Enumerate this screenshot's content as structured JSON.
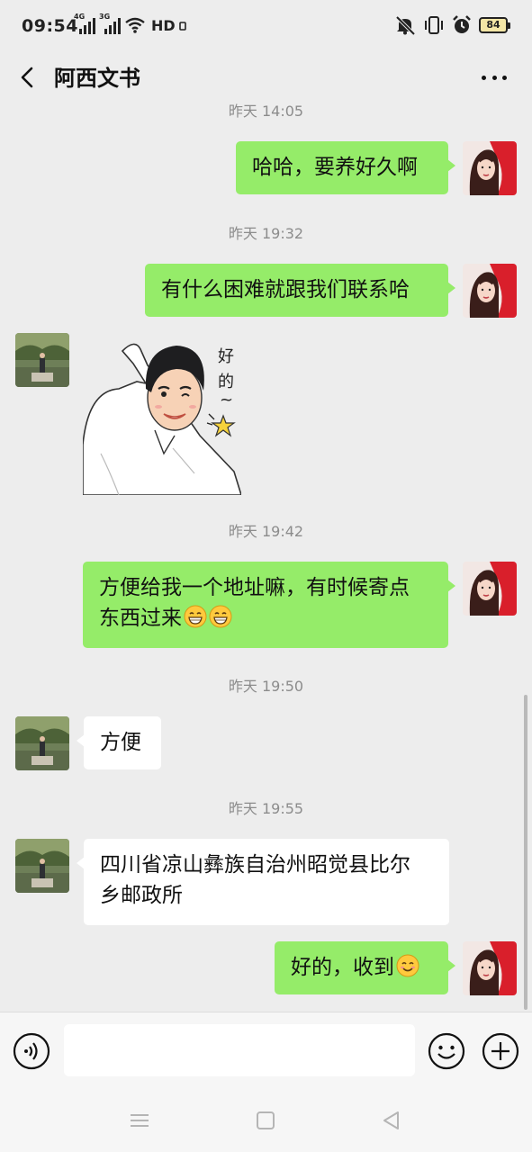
{
  "status_bar": {
    "time": "09:54",
    "net1_label": "4G",
    "net2_label": "3G",
    "hd_label": "HD",
    "battery": "84"
  },
  "header": {
    "title": "阿西文书"
  },
  "messages": [
    {
      "type": "timestamp",
      "text": "昨天 14:05"
    },
    {
      "type": "text",
      "from": "me",
      "text": "哈哈，要养好久啊"
    },
    {
      "type": "timestamp",
      "text": "昨天 19:32"
    },
    {
      "type": "text",
      "from": "me",
      "text": "有什么困难就跟我们联系哈"
    },
    {
      "type": "sticker",
      "from": "other",
      "caption": "好的~"
    },
    {
      "type": "timestamp",
      "text": "昨天 19:42"
    },
    {
      "type": "text",
      "from": "me",
      "line1": "方便给我一个地址嘛，有时候寄点",
      "line2": "东西过来",
      "emojis": [
        "grin-emoji",
        "grin-emoji"
      ]
    },
    {
      "type": "timestamp",
      "text": "昨天 19:50"
    },
    {
      "type": "text",
      "from": "other",
      "text": "方便"
    },
    {
      "type": "timestamp",
      "text": "昨天 19:55"
    },
    {
      "type": "text",
      "from": "other",
      "line1": "四川省凉山彝族自治州昭觉县比尔",
      "line2": "乡邮政所"
    },
    {
      "type": "text",
      "from": "me",
      "text": "好的，收到",
      "emojis": [
        "smile-emoji"
      ]
    }
  ],
  "input_bar": {
    "placeholder": ""
  },
  "icons": {
    "back": "chevron-left-icon",
    "more": "more-dots-icon",
    "voice": "voice-icon",
    "emoji": "emoji-icon",
    "plus": "plus-icon",
    "mute": "mute-icon",
    "vibrate": "vibrate-icon",
    "alarm": "alarm-icon",
    "wifi": "wifi-icon"
  },
  "colors": {
    "my_bubble": "#95ec69",
    "other_bubble": "#ffffff",
    "background": "#ededed"
  }
}
